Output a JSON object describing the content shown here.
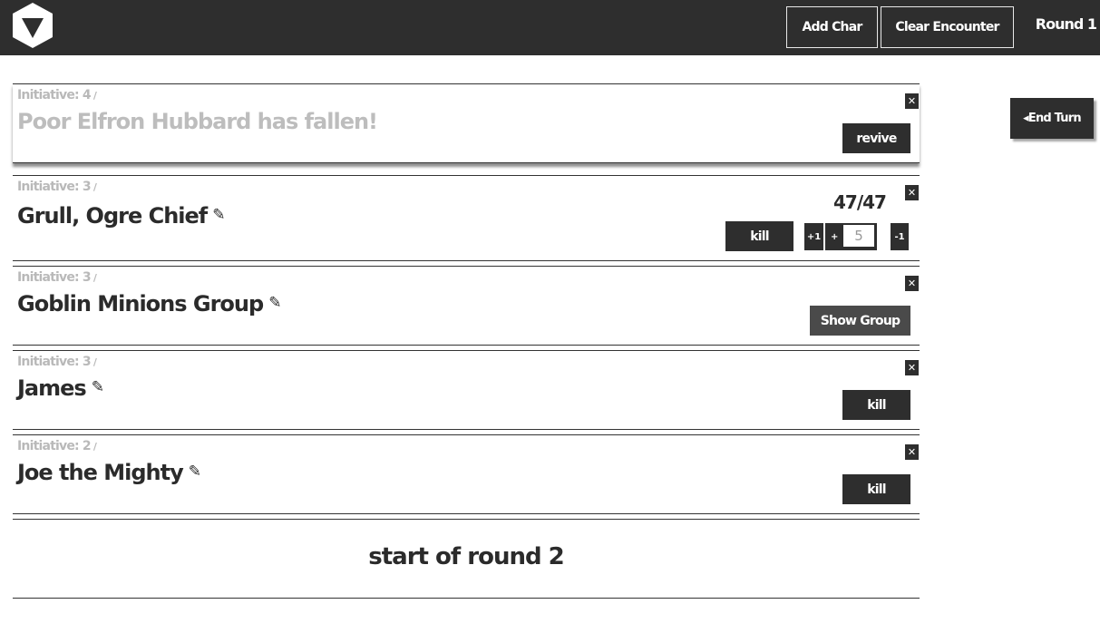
{
  "header": {
    "logo_icon": "down-triangle-hexagon-icon",
    "add_char_label": "Add Char",
    "clear_encounter_label": "Clear Encounter",
    "round_label": "Round 1"
  },
  "end_turn_label": "◂End Turn",
  "combatants": [
    {
      "initiative": "Initiative: 4",
      "name": "Poor Elfron Hubbard has fallen!",
      "action_label": "revive",
      "fallen": true
    },
    {
      "initiative": "Initiative: 3",
      "name": "Grull, Ogre Chief",
      "action_label": "kill",
      "hp": "47/47",
      "stepper": {
        "plus_one": "+1",
        "plus": "+",
        "value": "5",
        "minus": "-",
        "minus_one": "-1"
      }
    },
    {
      "initiative": "Initiative: 3",
      "name": "Goblin Minions Group",
      "action_label": "Show Group"
    },
    {
      "initiative": "Initiative: 3",
      "name": "James",
      "action_label": "kill"
    },
    {
      "initiative": "Initiative: 2",
      "name": "Joe the Mighty",
      "action_label": "kill"
    }
  ],
  "close_glyph": "✕",
  "round_end_text": "start of round 2",
  "colors": {
    "bar": "#2e2e2e",
    "muted": "#b9b9b9",
    "accent_btn": "#4a4a4a"
  }
}
